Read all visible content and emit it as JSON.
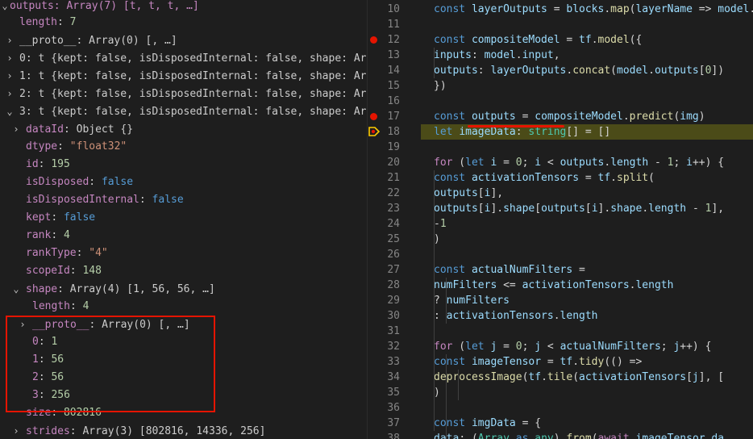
{
  "vars": {
    "outputs_header": "outputs: Array(7) [t, t, t, …]",
    "length_key": "length",
    "length_val": "7",
    "proto1": "__proto__: Array(0) [, …]",
    "item0": "0: t {kept: false, isDisposedInternal: false, shape: Array(…",
    "item1": "1: t {kept: false, isDisposedInternal: false, shape: Array(…",
    "item2": "2: t {kept: false, isDisposedInternal: false, shape: Array(…",
    "item3": "3: t {kept: false, isDisposedInternal: false, shape: Array(…",
    "dataId_key": "dataId",
    "dataId_val": "Object {}",
    "dtype_key": "dtype",
    "dtype_val": "\"float32\"",
    "id_key": "id",
    "id_val": "195",
    "isDisposed_key": "isDisposed",
    "isDisposed_val": "false",
    "isDisposedInternal_key": "isDisposedInternal",
    "isDisposedInternal_val": "false",
    "kept_key": "kept",
    "kept_val": "false",
    "rank_key": "rank",
    "rank_val": "4",
    "rankType_key": "rankType",
    "rankType_val": "\"4\"",
    "scopeId_key": "scopeId",
    "scopeId_val": "148",
    "shape_key": "shape",
    "shape_val": "Array(4) [1, 56, 56, …]",
    "shape_length_key": "length",
    "shape_length_val": "4",
    "shape_proto_key": "__proto__",
    "shape_proto_val": "Array(0) [, …]",
    "s0_key": "0",
    "s0_val": "1",
    "s1_key": "1",
    "s1_val": "56",
    "s2_key": "2",
    "s2_val": "56",
    "s3_key": "3",
    "s3_val": "256",
    "size_key": "size",
    "size_val": "802816",
    "strides_key": "strides",
    "strides_val": "Array(3) [802816, 14336, 256]"
  },
  "editor": {
    "lines": [
      {
        "n": "10",
        "t": "const layerOutputs = blocks.map(layerName => model.g"
      },
      {
        "n": "11",
        "t": ""
      },
      {
        "n": "12",
        "t": "const compositeModel = tf.model({"
      },
      {
        "n": "13",
        "t": "  inputs: model.input,"
      },
      {
        "n": "14",
        "t": "  outputs: layerOutputs.concat(model.outputs[0])"
      },
      {
        "n": "15",
        "t": "})"
      },
      {
        "n": "16",
        "t": ""
      },
      {
        "n": "17",
        "t": "const outputs = compositeModel.predict(img)"
      },
      {
        "n": "18",
        "t": "let imageData: string[] = []"
      },
      {
        "n": "19",
        "t": ""
      },
      {
        "n": "20",
        "t": "for (let i = 0; i < outputs.length - 1; i++) {"
      },
      {
        "n": "21",
        "t": "  const activationTensors = tf.split("
      },
      {
        "n": "22",
        "t": "    outputs[i],"
      },
      {
        "n": "23",
        "t": "    outputs[i].shape[outputs[i].shape.length - 1],"
      },
      {
        "n": "24",
        "t": "    -1"
      },
      {
        "n": "25",
        "t": "  )"
      },
      {
        "n": "26",
        "t": ""
      },
      {
        "n": "27",
        "t": "  const actualNumFilters ="
      },
      {
        "n": "28",
        "t": "    numFilters <= activationTensors.length"
      },
      {
        "n": "29",
        "t": "      ? numFilters"
      },
      {
        "n": "30",
        "t": "      : activationTensors.length"
      },
      {
        "n": "31",
        "t": ""
      },
      {
        "n": "32",
        "t": "  for (let j = 0; j < actualNumFilters; j++) {"
      },
      {
        "n": "33",
        "t": "    const imageTensor = tf.tidy(() =>"
      },
      {
        "n": "34",
        "t": "      deprocessImage(tf.tile(activationTensors[j], ["
      },
      {
        "n": "35",
        "t": "    )"
      },
      {
        "n": "36",
        "t": ""
      },
      {
        "n": "37",
        "t": "    const imgData = {"
      },
      {
        "n": "38",
        "t": "      data: (Array as any).from(await imageTensor.da"
      }
    ]
  },
  "colors": {
    "breakpoint": "#e51400",
    "highlight": "#4b4b18",
    "annotation": "#e51400"
  }
}
